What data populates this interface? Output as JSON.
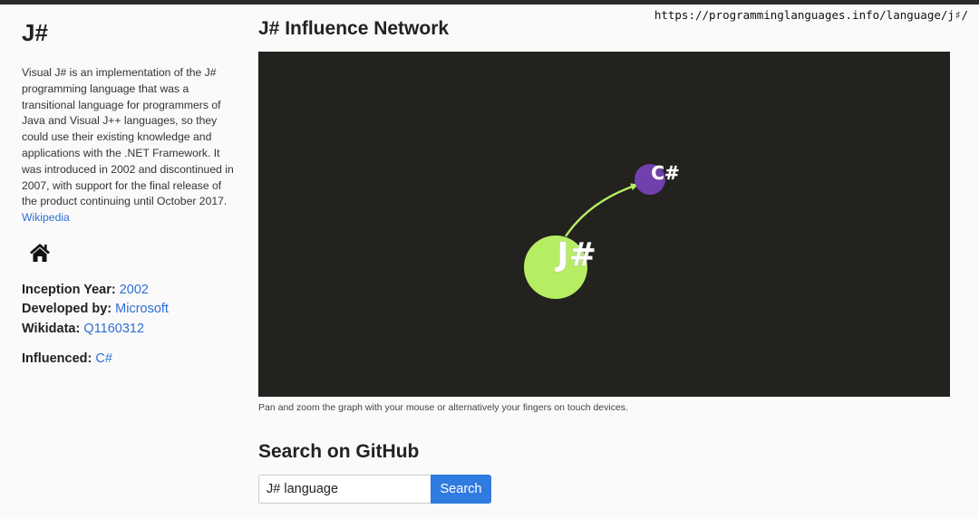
{
  "browser": {
    "url": "https://programminglanguages.info/language/j♯/"
  },
  "language": {
    "name": "J#",
    "description": "Visual J# is an implementation of the J# programming language that was a transitional language for programmers of Java and Visual J++ languages, so they could use their existing knowledge and applications with the .NET Framework. It was introduced in 2002 and discontinued in 2007, with support for the final release of the product continuing until October 2017.",
    "wikipedia_link": "Wikipedia",
    "home_icon": "home-icon"
  },
  "facts": {
    "inception_label": "Inception Year:",
    "inception_value": "2002",
    "developer_label": "Developed by:",
    "developer_value": "Microsoft",
    "wikidata_label": "Wikidata:",
    "wikidata_value": "Q1160312",
    "influenced_label": "Influenced:",
    "influenced_value": "C#"
  },
  "network": {
    "title": "J# Influence Network",
    "background_color": "#23221f",
    "edge_color": "#b6ee63",
    "nodes": [
      {
        "label": "J#",
        "color": "#b6ee63"
      },
      {
        "label": "C#",
        "color": "#7140ad"
      }
    ],
    "caption": "Pan and zoom the graph with your mouse or alternatively your fingers on touch devices."
  },
  "github": {
    "title": "Search on GitHub",
    "query_value": "J# language",
    "button_label": "Search",
    "button_color": "#2f7be0"
  }
}
